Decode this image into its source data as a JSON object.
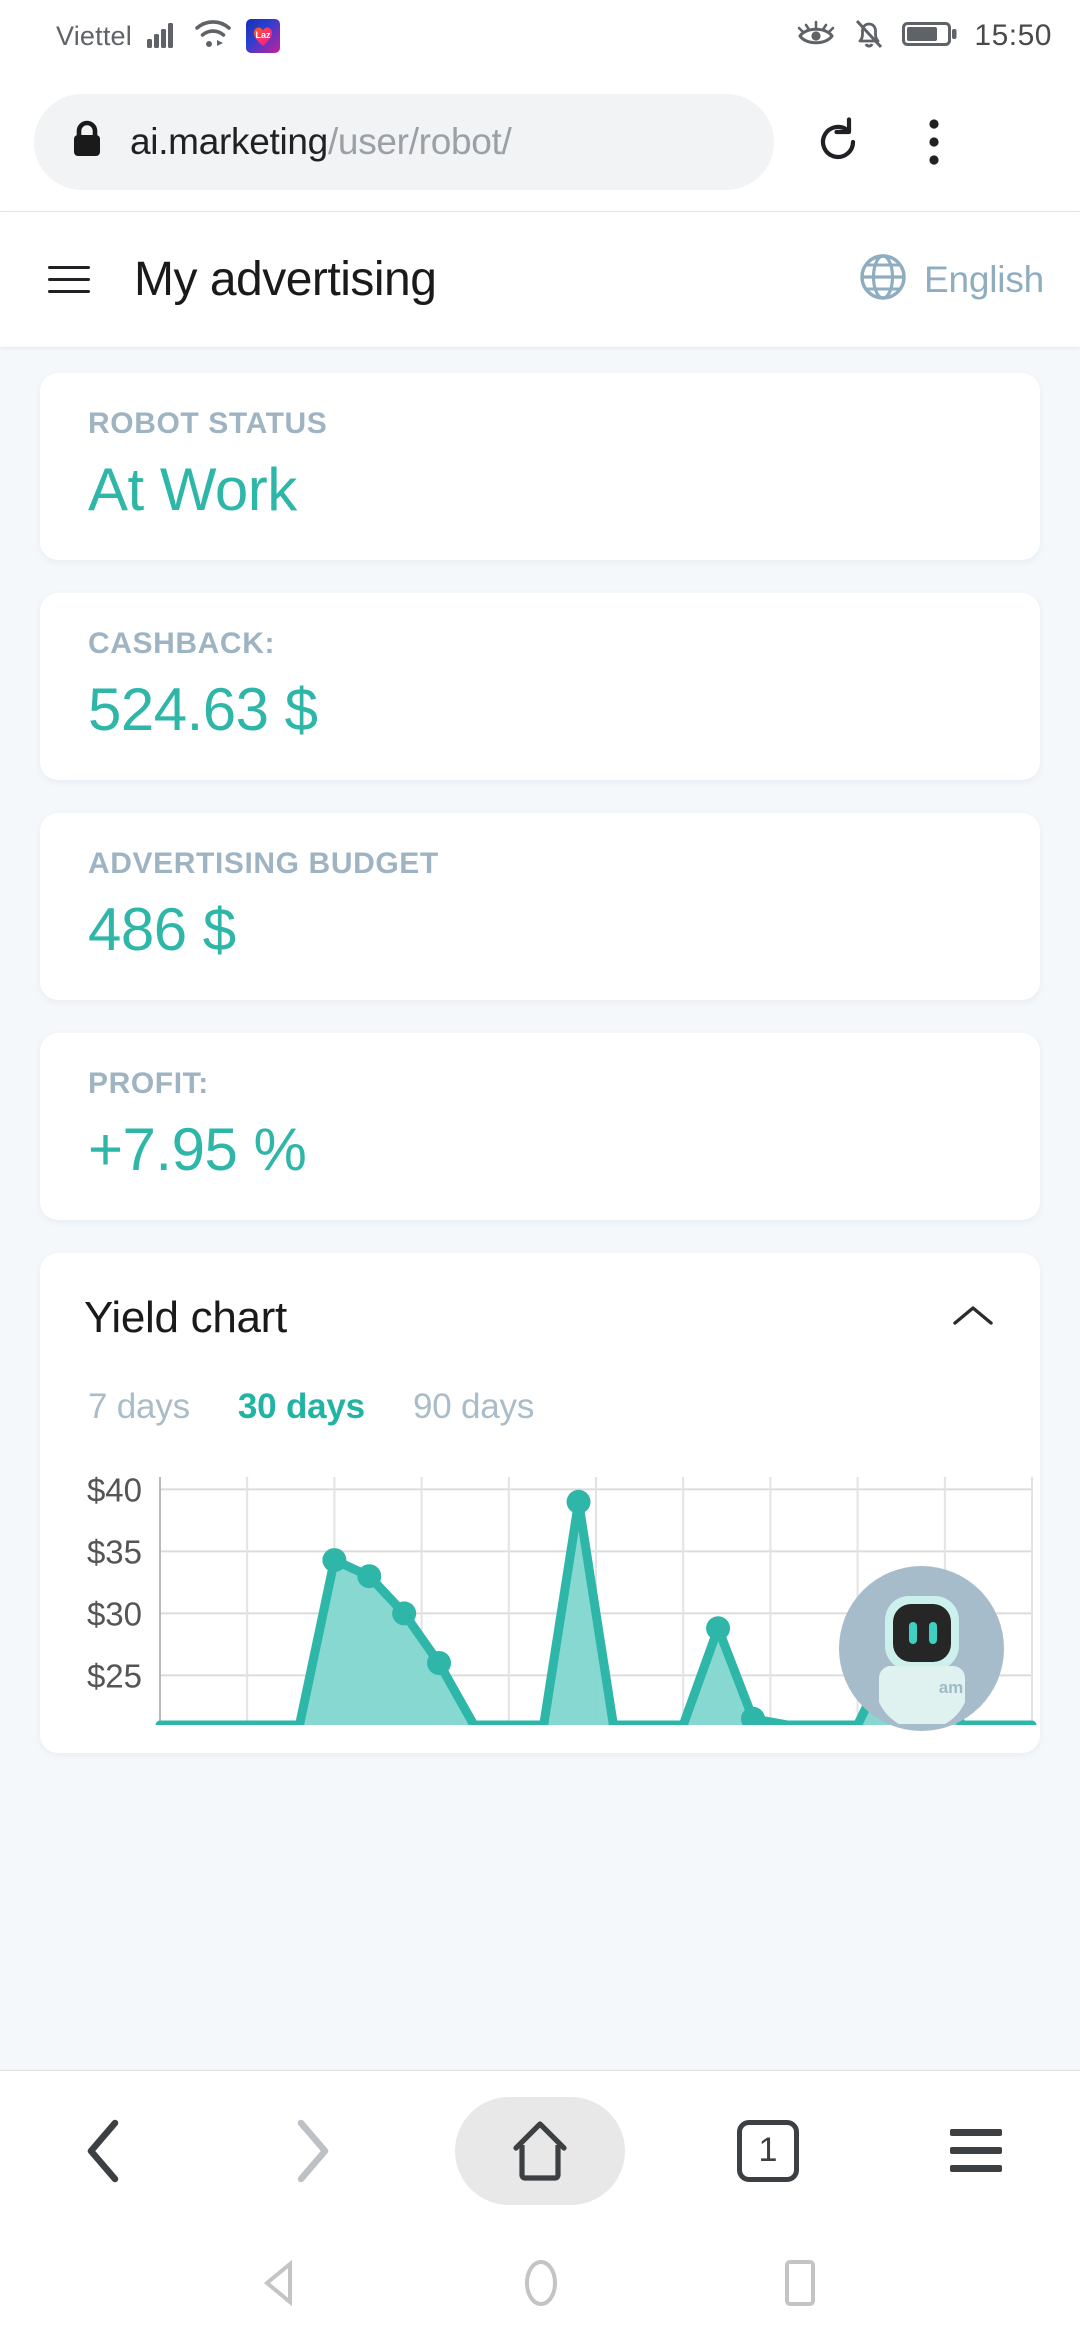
{
  "status_bar": {
    "carrier": "Viettel",
    "time": "15:50",
    "icons": [
      "signal-icon",
      "wifi-icon",
      "lazada-app-icon",
      "eye-comfort-icon",
      "silent-bell-icon",
      "battery-icon"
    ],
    "lazada_label": "Laz"
  },
  "browser": {
    "url_domain": "ai.marketing",
    "url_path": "/user/robot/",
    "lock_icon": "lock-icon",
    "reload_icon": "reload-icon",
    "overflow_icon": "more-vertical-icon",
    "bottom": {
      "back_label": "back-icon",
      "forward_label": "forward-icon",
      "home_label": "home-icon",
      "tab_count": "1",
      "menu_label": "menu-icon"
    }
  },
  "app_header": {
    "menu_icon": "hamburger-icon",
    "title": "My advertising",
    "globe_icon": "globe-icon",
    "language": "English"
  },
  "cards": [
    {
      "label": "ROBOT STATUS",
      "value": "At Work"
    },
    {
      "label": "CASHBACK:",
      "value": "524.63 $"
    },
    {
      "label": "ADVERTISING BUDGET",
      "value": "486 $"
    },
    {
      "label": "PROFIT:",
      "value": "+7.95 %"
    }
  ],
  "yield_chart": {
    "title": "Yield chart",
    "collapse_icon": "chevron-up-icon",
    "tabs": [
      {
        "label": "7 days",
        "active": false
      },
      {
        "label": "30 days",
        "active": true
      },
      {
        "label": "90 days",
        "active": false
      }
    ]
  },
  "robot_fab": {
    "icon": "robot-avatar-icon",
    "logo_text": "am"
  },
  "android_nav": {
    "back_icon": "nav-back-triangle-icon",
    "home_icon": "nav-home-circle-icon",
    "recents_icon": "nav-recents-square-icon"
  },
  "colors": {
    "accent_teal": "#2eb6a8",
    "area_fill": "#7fd6cd",
    "muted_label": "#9fb4c2",
    "page_bg": "#f4f8fb",
    "tab_inactive": "#a9bcc8",
    "robot_circle": "#a7bccb"
  },
  "chart_data": {
    "type": "area",
    "title": "Yield chart",
    "xlabel": "",
    "ylabel": "",
    "ytick_labels": [
      "$40",
      "$35",
      "$30",
      "$25"
    ],
    "ytick_values": [
      40,
      35,
      30,
      25
    ],
    "ylim": [
      21,
      41
    ],
    "grid": true,
    "legend": null,
    "note": "Daily yield over 30 days; plot is clipped at the bottom of the viewport by the browser toolbar.",
    "x": [
      1,
      2,
      3,
      4,
      5,
      6,
      7,
      8,
      9,
      10,
      11,
      12,
      13,
      14,
      15,
      16,
      17,
      18,
      19,
      20,
      21,
      22,
      23,
      24,
      25,
      26
    ],
    "values": [
      21,
      21,
      21,
      21,
      21,
      34.3,
      33.0,
      30.0,
      26.0,
      21,
      21,
      21,
      39.0,
      21,
      21,
      21,
      28.8,
      21.5,
      21,
      21,
      21,
      26.8,
      25.5,
      21,
      21,
      21
    ],
    "series": [
      {
        "name": "Yield",
        "values": [
          21,
          21,
          21,
          21,
          21,
          34.3,
          33.0,
          30.0,
          26.0,
          21,
          21,
          21,
          39.0,
          21,
          21,
          21,
          28.8,
          21.5,
          21,
          21,
          21,
          26.8,
          25.5,
          21,
          21,
          21
        ]
      }
    ],
    "markers": [
      {
        "x": 6,
        "y": 34.3
      },
      {
        "x": 7,
        "y": 33.0
      },
      {
        "x": 8,
        "y": 30.0
      },
      {
        "x": 9,
        "y": 26.0
      },
      {
        "x": 13,
        "y": 39.0
      },
      {
        "x": 17,
        "y": 28.8
      },
      {
        "x": 18,
        "y": 21.5
      },
      {
        "x": 22,
        "y": 26.8
      },
      {
        "x": 23,
        "y": 25.5
      }
    ]
  }
}
